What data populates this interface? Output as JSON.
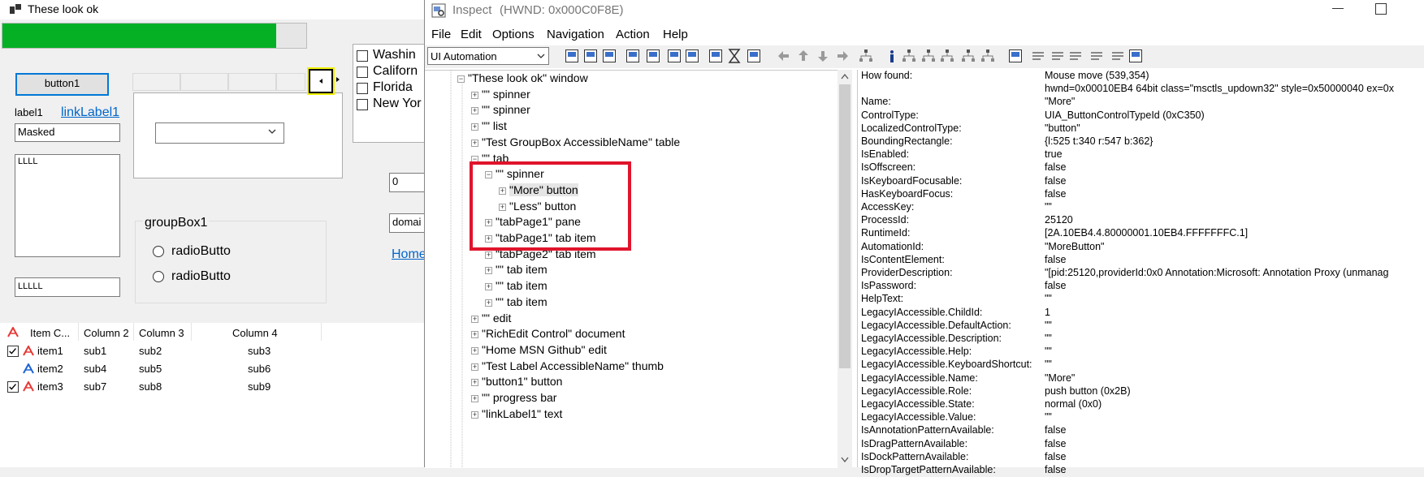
{
  "app": {
    "title": "These look ok",
    "progress": 0.9,
    "button1": "button1",
    "label1": "label1",
    "linkLabel1": "linkLabel1",
    "masked": "Masked",
    "textarea": "LLLL",
    "textbox2": "LLLLL",
    "groupbox_title": "groupBox1",
    "radio1": "radioButto",
    "radio2": "radioButto",
    "checklist": [
      "Washin",
      "Californ",
      "Florida",
      "New Yor"
    ],
    "numeric_value": "0",
    "domain_value": "domai",
    "home_link": "Home",
    "listview": {
      "columns": [
        "Item C...",
        "Column 2",
        "Column 3",
        "Column 4"
      ],
      "rows": [
        {
          "checked": true,
          "cells": [
            "item1",
            "sub1",
            "sub2",
            "sub3"
          ],
          "color": "#e53935"
        },
        {
          "checked": false,
          "cells": [
            "item2",
            "sub4",
            "sub5",
            "sub6"
          ],
          "color": "#1e63d6"
        },
        {
          "checked": true,
          "cells": [
            "item3",
            "sub7",
            "sub8",
            "sub9"
          ],
          "color": "#e53935"
        }
      ]
    }
  },
  "inspect": {
    "title": "Inspect",
    "hwnd": "(HWND: 0x000C0F8E)",
    "menu": [
      "File",
      "Edit",
      "Options",
      "Navigation",
      "Action",
      "Help"
    ],
    "mode_select": "UI Automation",
    "tree": [
      {
        "level": 0,
        "text": "\"These look ok\" window",
        "exp": "−"
      },
      {
        "level": 1,
        "text": "\"\" spinner",
        "exp": "+"
      },
      {
        "level": 1,
        "text": "\"\" spinner",
        "exp": "+"
      },
      {
        "level": 1,
        "text": "\"\" list",
        "exp": "+"
      },
      {
        "level": 1,
        "text": "\"Test GroupBox AccessibleName\" table",
        "exp": "+"
      },
      {
        "level": 1,
        "text": "\"\" tab",
        "exp": "−"
      },
      {
        "level": 2,
        "text": "\"\" spinner",
        "exp": "−"
      },
      {
        "level": 3,
        "text": "\"More\" button",
        "exp": "+",
        "selected": true
      },
      {
        "level": 3,
        "text": "\"Less\" button",
        "exp": "+"
      },
      {
        "level": 2,
        "text": "\"tabPage1\" pane",
        "exp": "+"
      },
      {
        "level": 2,
        "text": "\"tabPage1\" tab item",
        "exp": "+"
      },
      {
        "level": 2,
        "text": "\"tabPage2\" tab item",
        "exp": "+"
      },
      {
        "level": 2,
        "text": "\"\" tab item",
        "exp": "+"
      },
      {
        "level": 2,
        "text": "\"\" tab item",
        "exp": "+"
      },
      {
        "level": 2,
        "text": "\"\" tab item",
        "exp": "+"
      },
      {
        "level": 1,
        "text": "\"\" edit",
        "exp": "+"
      },
      {
        "level": 1,
        "text": "\"RichEdit Control\" document",
        "exp": "+"
      },
      {
        "level": 1,
        "text": "\"Home MSN Github\" edit",
        "exp": "+"
      },
      {
        "level": 1,
        "text": "\"Test Label AccessibleName\" thumb",
        "exp": "+"
      },
      {
        "level": 1,
        "text": "\"button1\" button",
        "exp": "+"
      },
      {
        "level": 1,
        "text": "\"\" progress bar",
        "exp": "+"
      },
      {
        "level": 1,
        "text": "\"linkLabel1\" text",
        "exp": "+"
      }
    ],
    "details": [
      [
        "How found:",
        "Mouse move (539,354)"
      ],
      [
        "",
        "hwnd=0x00010EB4 64bit class=\"msctls_updown32\" style=0x50000040 ex=0x"
      ],
      [
        "Name:",
        "\"More\""
      ],
      [
        "ControlType:",
        "UIA_ButtonControlTypeId (0xC350)"
      ],
      [
        "LocalizedControlType:",
        "\"button\""
      ],
      [
        "BoundingRectangle:",
        "{l:525 t:340 r:547 b:362}"
      ],
      [
        "IsEnabled:",
        "true"
      ],
      [
        "IsOffscreen:",
        "false"
      ],
      [
        "IsKeyboardFocusable:",
        "false"
      ],
      [
        "HasKeyboardFocus:",
        "false"
      ],
      [
        "AccessKey:",
        "\"\""
      ],
      [
        "ProcessId:",
        "25120"
      ],
      [
        "RuntimeId:",
        "[2A.10EB4.4.80000001.10EB4.FFFFFFFC.1]"
      ],
      [
        "AutomationId:",
        "\"MoreButton\""
      ],
      [
        "IsContentElement:",
        "false"
      ],
      [
        "ProviderDescription:",
        "\"[pid:25120,providerId:0x0 Annotation:Microsoft: Annotation Proxy (unmanag"
      ],
      [
        "IsPassword:",
        "false"
      ],
      [
        "HelpText:",
        "\"\""
      ],
      [
        "LegacyIAccessible.ChildId:",
        "1"
      ],
      [
        "LegacyIAccessible.DefaultAction:",
        "\"\""
      ],
      [
        "LegacyIAccessible.Description:",
        "\"\""
      ],
      [
        "LegacyIAccessible.Help:",
        "\"\""
      ],
      [
        "LegacyIAccessible.KeyboardShortcut:",
        "\"\""
      ],
      [
        "LegacyIAccessible.Name:",
        "\"More\""
      ],
      [
        "LegacyIAccessible.Role:",
        "push button (0x2B)"
      ],
      [
        "LegacyIAccessible.State:",
        "normal (0x0)"
      ],
      [
        "LegacyIAccessible.Value:",
        "\"\""
      ],
      [
        "IsAnnotationPatternAvailable:",
        "false"
      ],
      [
        "IsDragPatternAvailable:",
        "false"
      ],
      [
        "IsDockPatternAvailable:",
        "false"
      ],
      [
        "IsDropTargetPatternAvailable:",
        "false"
      ]
    ]
  }
}
